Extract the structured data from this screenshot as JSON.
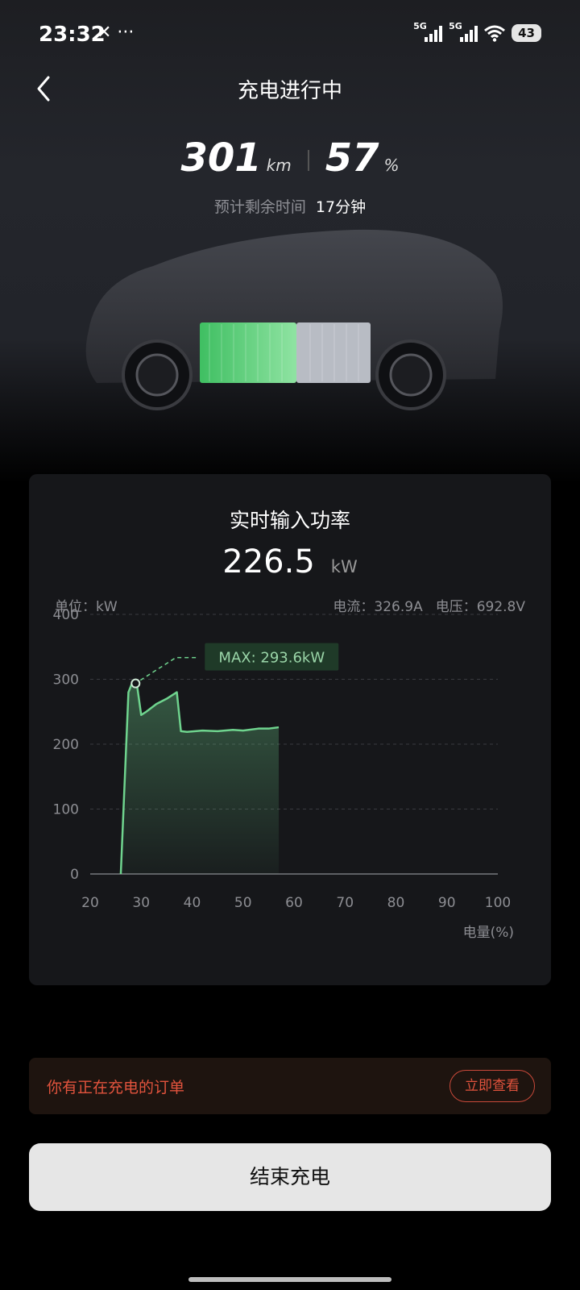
{
  "status_bar": {
    "time": "23:32",
    "extra": "✕ ···",
    "signal1_label": "5G",
    "signal2_label": "5G",
    "battery": "43"
  },
  "header": {
    "title": "充电进行中",
    "back_icon": "chevron-left-icon"
  },
  "summary": {
    "range_value": "301",
    "range_unit": "km",
    "soc_value": "57",
    "soc_unit": "%",
    "remaining_label": "预计剩余时间",
    "remaining_value": "17分钟"
  },
  "power_card": {
    "title": "实时输入功率",
    "value": "226.5",
    "unit": "kW",
    "unit_label": "单位：kW",
    "current": "电流：326.9A",
    "voltage": "电压：692.8V"
  },
  "chart_data": {
    "type": "area",
    "title": "",
    "xlabel": "电量(%)",
    "ylabel": "kW",
    "xlim": [
      20,
      100
    ],
    "ylim": [
      0,
      400
    ],
    "x_ticks": [
      "20",
      "30",
      "40",
      "50",
      "60",
      "70",
      "80",
      "90",
      "100"
    ],
    "y_ticks": [
      "0",
      "100",
      "200",
      "300",
      "400"
    ],
    "grid": true,
    "series": [
      {
        "x": [
          26,
          27.5,
          28.2,
          29.2,
          30,
          31,
          33,
          35,
          37,
          37.8,
          39,
          42,
          45,
          48,
          50,
          53,
          55,
          57
        ],
        "values": [
          0,
          280,
          293.6,
          290,
          245,
          250,
          262,
          270,
          280,
          220,
          219,
          221,
          220,
          222,
          221,
          224,
          224,
          226
        ]
      }
    ],
    "annotation": {
      "text": "MAX: 293.6kW",
      "x": 28.9,
      "y": 293.6
    },
    "color": "#6fd48e"
  },
  "order": {
    "text": "你有正在充电的订单",
    "button": "立即查看"
  },
  "end_button": "结束充电"
}
